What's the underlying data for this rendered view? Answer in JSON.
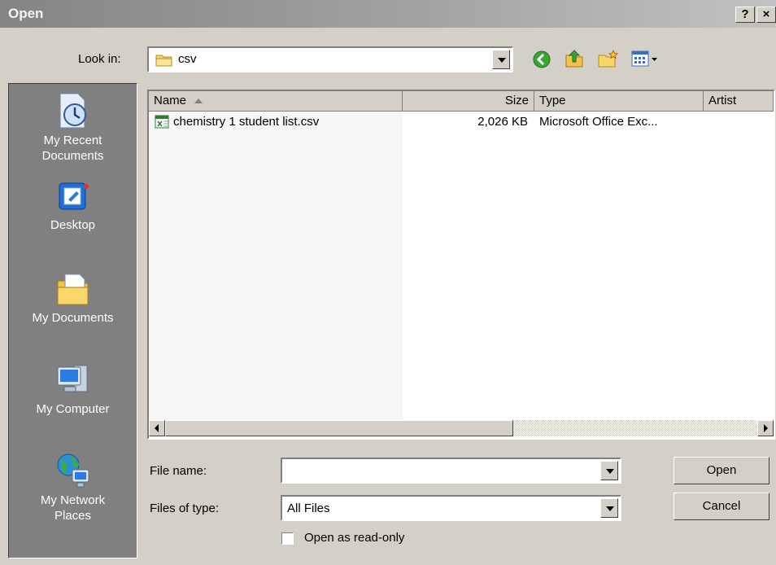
{
  "window": {
    "title": "Open",
    "help_label": "?",
    "close_label": "×"
  },
  "look_in": {
    "label": "Look in:",
    "value": "csv"
  },
  "toolbar": {
    "back_icon": "back-arrow-icon",
    "up_icon": "up-folder-icon",
    "new_folder_icon": "new-folder-icon",
    "views_icon": "views-menu-icon"
  },
  "places": [
    {
      "label": "My Recent\nDocuments",
      "icon": "recent-documents-icon"
    },
    {
      "label": "Desktop",
      "icon": "desktop-icon"
    },
    {
      "label": "My Documents",
      "icon": "my-documents-icon"
    },
    {
      "label": "My Computer",
      "icon": "my-computer-icon"
    },
    {
      "label": "My Network\nPlaces",
      "icon": "network-places-icon"
    }
  ],
  "columns": {
    "name": "Name",
    "size": "Size",
    "type": "Type",
    "artist": "Artist"
  },
  "files": [
    {
      "name": "chemistry 1 student list.csv",
      "size": "2,026 KB",
      "type": "Microsoft Office Exc...",
      "artist": "",
      "icon": "excel-csv-icon"
    }
  ],
  "file_name": {
    "label": "File name:",
    "value": ""
  },
  "file_type": {
    "label": "Files of type:",
    "value": "All Files"
  },
  "read_only": {
    "label": "Open as read-only",
    "checked": false
  },
  "buttons": {
    "open": "Open",
    "cancel": "Cancel"
  }
}
